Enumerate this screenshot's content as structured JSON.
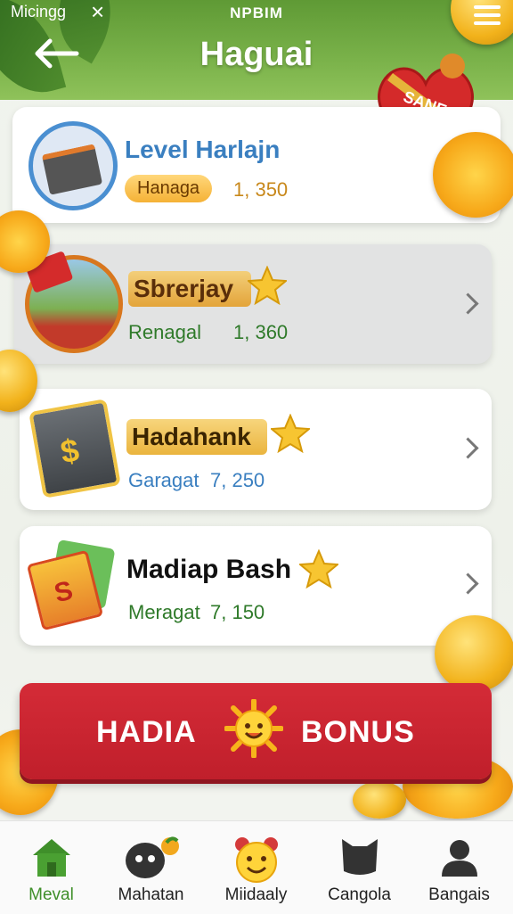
{
  "status": {
    "left": "Micingg",
    "center": "NPBIM"
  },
  "header": {
    "title": "Haguai"
  },
  "heart": {
    "label": "SANE"
  },
  "cards": [
    {
      "title": "Level Harlajn",
      "badge": "Hanaga",
      "value": "1, 350"
    },
    {
      "title": "Sbrerjay",
      "label": "Renagal",
      "value": "1, 360"
    },
    {
      "title": "Hadahank",
      "label": "Garagat",
      "value": "7, 250"
    },
    {
      "title": "Madiap Bash",
      "label": "Meragat",
      "value": "7, 150"
    }
  ],
  "bonus": {
    "left": "HADIA",
    "right": "BONUS"
  },
  "nav": [
    {
      "label": "Meval",
      "icon": "home-icon",
      "active": true
    },
    {
      "label": "Mahatan",
      "icon": "monster-icon"
    },
    {
      "label": "Miidaaly",
      "icon": "smiley-icon"
    },
    {
      "label": "Cangola",
      "icon": "cat-icon"
    },
    {
      "label": "Bangais",
      "icon": "user-icon"
    }
  ],
  "colors": {
    "header_green": "#6aa63c",
    "accent_blue": "#3a7fc0",
    "nav_active": "#4a9a2c",
    "bonus_red": "#c8232f"
  }
}
